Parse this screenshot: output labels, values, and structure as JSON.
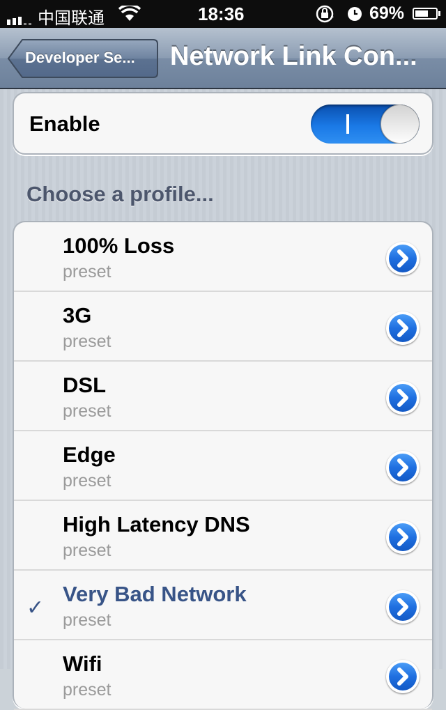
{
  "status_bar": {
    "carrier": "中国联通",
    "time": "18:36",
    "battery_percent": "69%",
    "battery_level": 0.69,
    "icons": [
      "signal-icon",
      "wifi-icon",
      "orientation-lock-icon",
      "alarm-icon",
      "battery-icon"
    ]
  },
  "nav": {
    "back_label": "Developer Se...",
    "title": "Network Link Con..."
  },
  "enable": {
    "label": "Enable",
    "state": "on"
  },
  "section": {
    "header": "Choose a profile..."
  },
  "profiles": [
    {
      "title": "100% Loss",
      "subtitle": "preset",
      "selected": false
    },
    {
      "title": "3G",
      "subtitle": "preset",
      "selected": false
    },
    {
      "title": "DSL",
      "subtitle": "preset",
      "selected": false
    },
    {
      "title": "Edge",
      "subtitle": "preset",
      "selected": false
    },
    {
      "title": "High Latency DNS",
      "subtitle": "preset",
      "selected": false
    },
    {
      "title": "Very Bad Network",
      "subtitle": "preset",
      "selected": true
    },
    {
      "title": "Wifi",
      "subtitle": "preset",
      "selected": false
    }
  ],
  "selected_mark": "✓",
  "colors": {
    "accent": "#1a79e6",
    "selected_text": "#385487",
    "navbar": "#8c9db3"
  }
}
